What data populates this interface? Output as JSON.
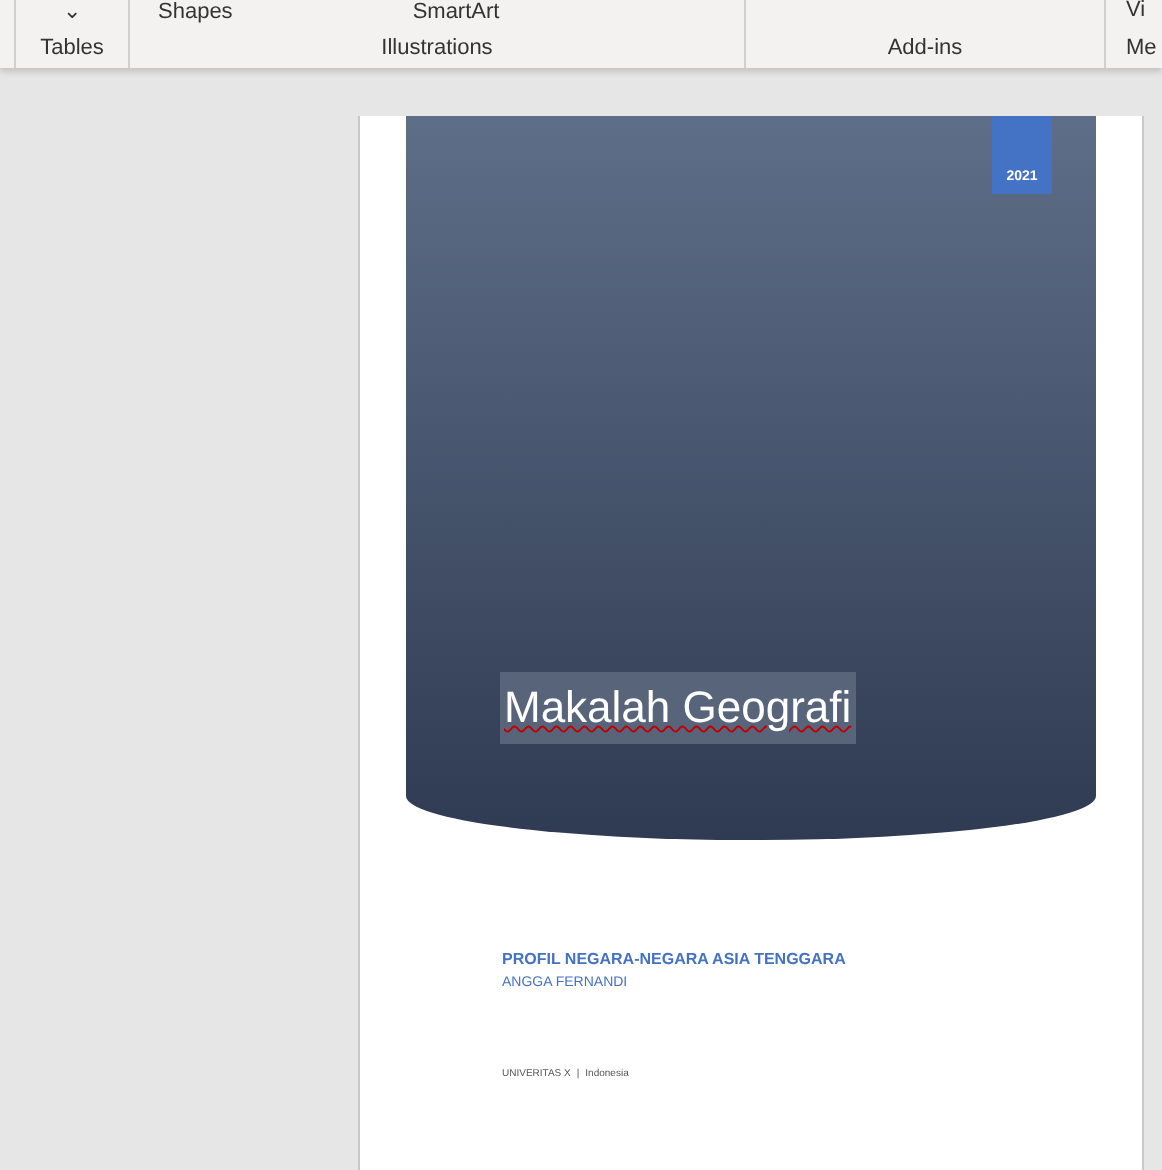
{
  "ribbon": {
    "groups": [
      {
        "label": "Tables",
        "items": [
          "⌄"
        ]
      },
      {
        "label": "Illustrations",
        "items": [
          "Shapes",
          "SmartArt"
        ]
      },
      {
        "label": "Add-ins"
      },
      {
        "label": "Me",
        "items": [
          "Vi"
        ]
      }
    ]
  },
  "document": {
    "year": "2021",
    "title": "Makalah Geografi",
    "subtitle": "PROFIL NEGARA-NEGARA ASIA TENGGARA",
    "author": "ANGGA FERNANDI",
    "company": "UNIVERITAS X",
    "separator": "|",
    "address": "Indonesia"
  }
}
